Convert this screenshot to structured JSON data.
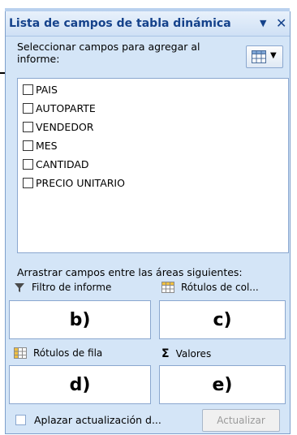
{
  "panel": {
    "title": "Lista de campos de tabla dinámica",
    "dropdown_glyph": "▼",
    "close_glyph": "✕"
  },
  "prompt": "Seleccionar campos para agregar al informe:",
  "fields": [
    {
      "label": "PAIS",
      "checked": false
    },
    {
      "label": "AUTOPARTE",
      "checked": false
    },
    {
      "label": "VENDEDOR",
      "checked": false
    },
    {
      "label": "MES",
      "checked": false
    },
    {
      "label": "CANTIDAD",
      "checked": false
    },
    {
      "label": "PRECIO UNITARIO",
      "checked": false
    }
  ],
  "areas": {
    "title": "Arrastrar campos entre las áreas siguientes:",
    "report_filter": {
      "label": "Filtro de informe",
      "icon": "filter-icon",
      "box": "b)"
    },
    "column_labels": {
      "label": "Rótulos de col...",
      "icon": "column-grid-icon",
      "box": "c)"
    },
    "row_labels": {
      "label": "Rótulos de fila",
      "icon": "row-grid-icon",
      "box": "d)"
    },
    "values": {
      "label": "Valores",
      "icon": "sigma-icon",
      "symbol": "Σ",
      "box": "e)"
    }
  },
  "footer": {
    "defer_label": "Aplazar actualización d...",
    "update_label": "Actualizar"
  },
  "colors": {
    "panel_bg": "#d4e5f7",
    "title_text": "#15428b",
    "border": "#8aa7cf"
  }
}
